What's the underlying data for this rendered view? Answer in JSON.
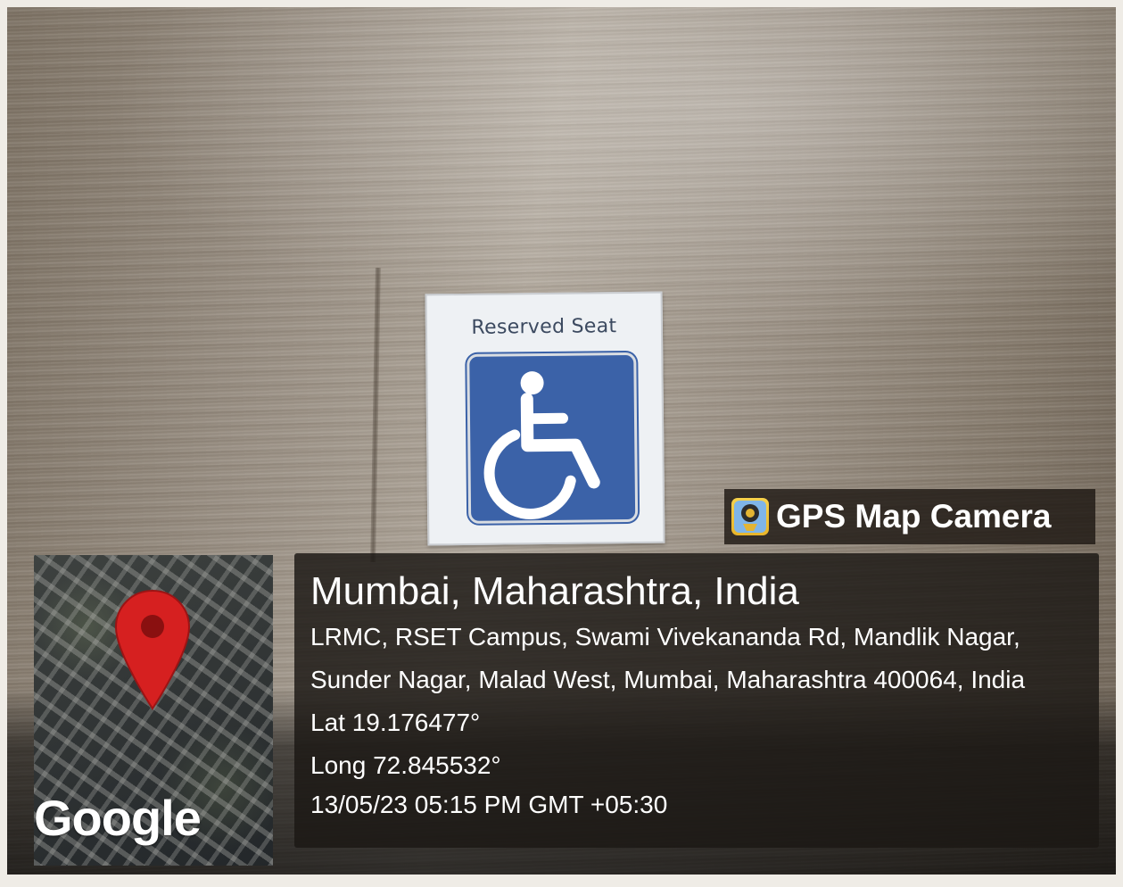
{
  "sign": {
    "title": "Reserved Seat",
    "symbol": "wheelchair-accessibility-icon",
    "badge_color": "#3b62a8"
  },
  "brand": {
    "label": "GPS Map Camera",
    "icon": "gps-map-camera-icon",
    "icon_color": "#f0c23a"
  },
  "location": {
    "title": "Mumbai, Maharashtra, India",
    "address_line1": "LRMC, RSET Campus, Swami Vivekananda Rd, Mandlik Nagar,",
    "address_line2": "Sunder Nagar, Malad West, Mumbai, Maharashtra 400064, India",
    "lat": "Lat 19.176477°",
    "long": "Long 72.845532°",
    "datetime": "13/05/23 05:15 PM GMT +05:30"
  },
  "map": {
    "attribution": "Google",
    "pin_icon": "map-pin-icon",
    "pin_color": "#d62020"
  }
}
